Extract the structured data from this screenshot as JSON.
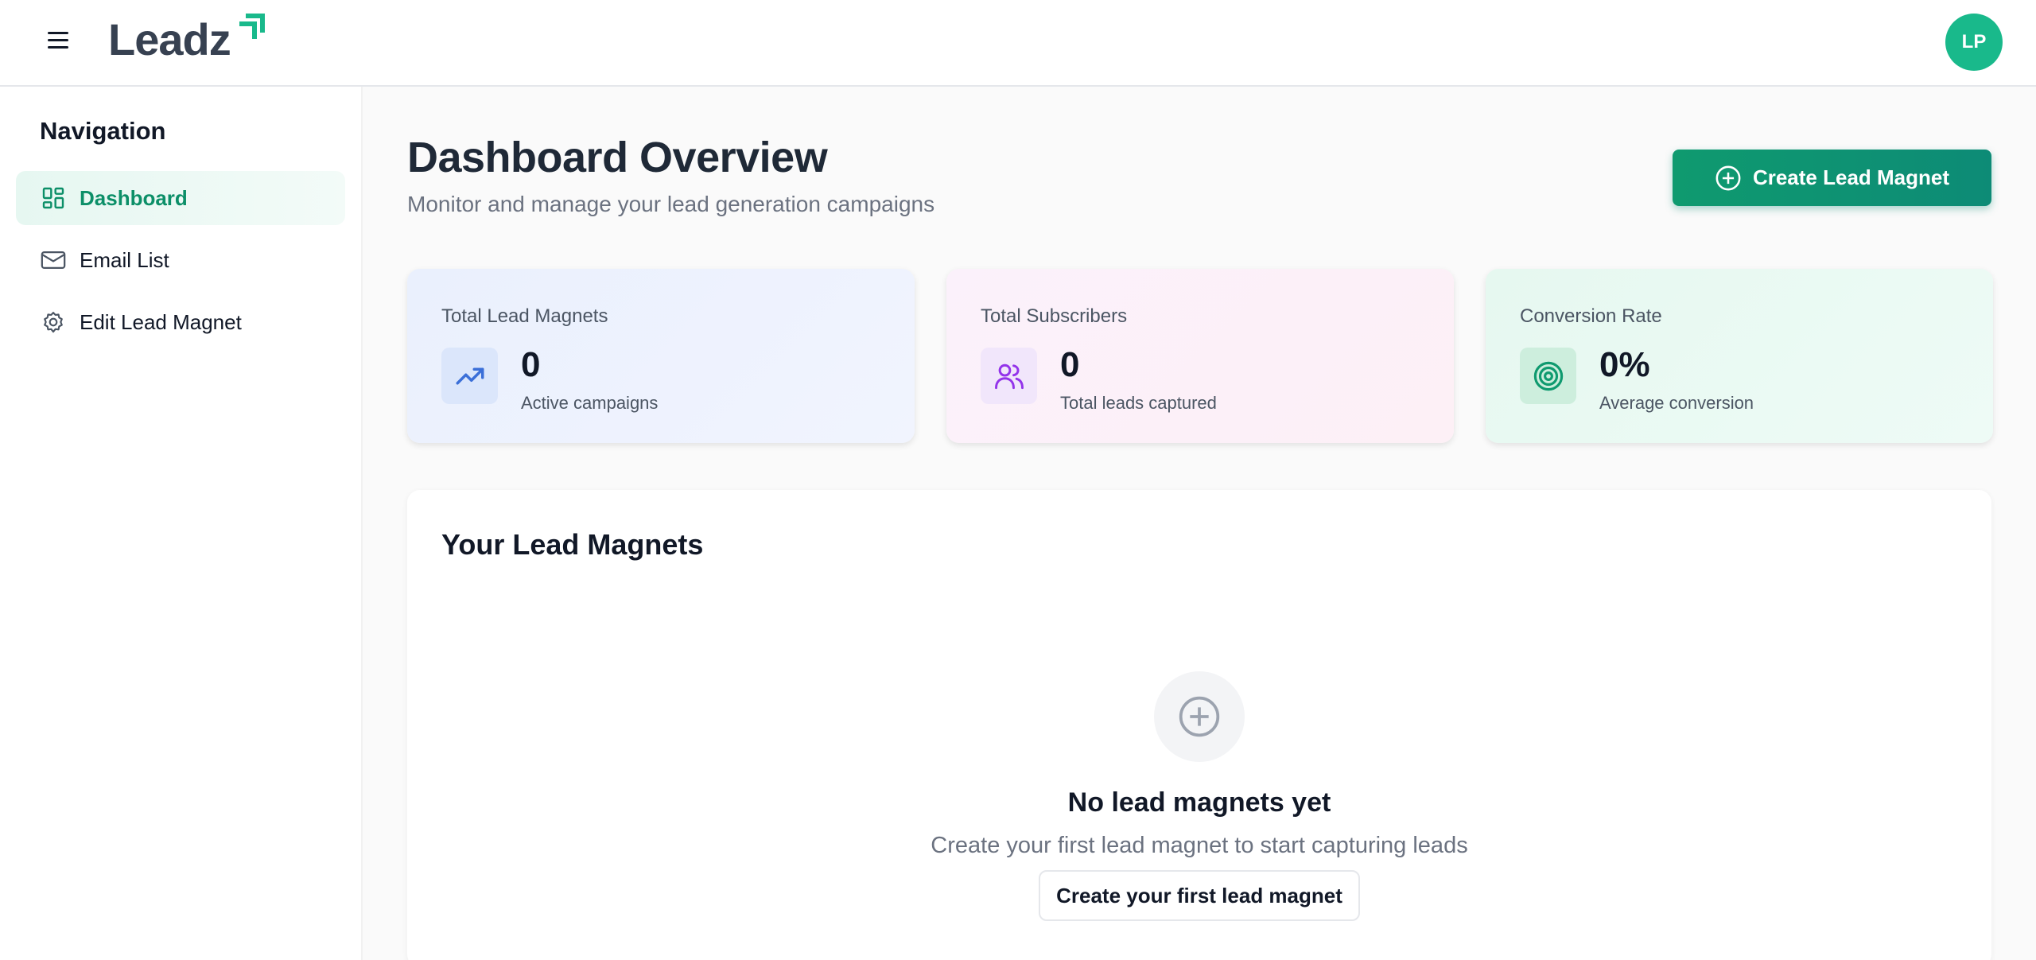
{
  "header": {
    "logo_text": "Leadz",
    "avatar_initials": "LP",
    "brand_color": "#19b98b"
  },
  "sidebar": {
    "title": "Navigation",
    "items": [
      {
        "label": "Dashboard",
        "icon": "dashboard-grid-icon",
        "active": true
      },
      {
        "label": "Email List",
        "icon": "mail-icon",
        "active": false
      },
      {
        "label": "Edit Lead Magnet",
        "icon": "gear-icon",
        "active": false
      }
    ]
  },
  "main": {
    "title": "Dashboard Overview",
    "subtitle": "Monitor and manage your lead generation campaigns",
    "create_button_label": "Create Lead Magnet",
    "stats": [
      {
        "label": "Total Lead Magnets",
        "value": "0",
        "caption": "Active campaigns",
        "icon": "trending-up-icon",
        "accent": "#3b6fd8"
      },
      {
        "label": "Total Subscribers",
        "value": "0",
        "caption": "Total leads captured",
        "icon": "users-icon",
        "accent": "#9333ea"
      },
      {
        "label": "Conversion Rate",
        "value": "0%",
        "caption": "Average conversion",
        "icon": "target-icon",
        "accent": "#0f9a6f"
      }
    ],
    "lead_magnets": {
      "title": "Your Lead Magnets",
      "empty_title": "No lead magnets yet",
      "empty_subtitle": "Create your first lead magnet to start capturing leads",
      "empty_button_label": "Create your first lead magnet"
    }
  }
}
